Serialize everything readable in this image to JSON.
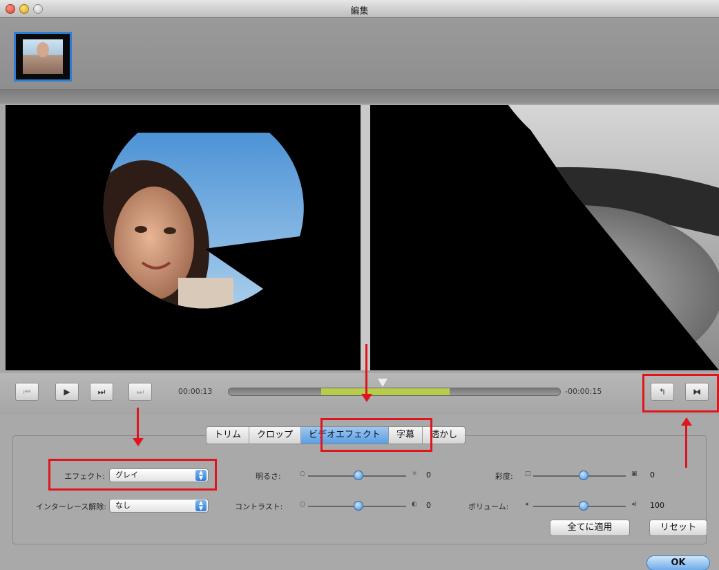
{
  "window": {
    "title": "編集"
  },
  "transport": {
    "buttons": [
      {
        "icon": "skip-back-icon",
        "glyph": "⏮"
      },
      {
        "icon": "play-icon",
        "glyph": "▶"
      },
      {
        "icon": "fast-forward-icon",
        "glyph": "⏭"
      },
      {
        "icon": "skip-end-icon",
        "glyph": "⏭"
      }
    ],
    "time_current": "00:00:13",
    "time_remaining": "-00:00:15",
    "extra_buttons": [
      {
        "icon": "mark-in-icon",
        "glyph": "↰"
      },
      {
        "icon": "split-icon",
        "glyph": "⧓"
      }
    ]
  },
  "tabs": [
    {
      "label": "トリム",
      "active": false
    },
    {
      "label": "クロップ",
      "active": false
    },
    {
      "label": "ビデオエフェクト",
      "active": true
    },
    {
      "label": "字幕",
      "active": false
    },
    {
      "label": "透かし",
      "active": false
    }
  ],
  "effect": {
    "label": "エフェクト:",
    "value": "グレイ"
  },
  "deinterlace": {
    "label": "インターレース解除:",
    "value": "なし"
  },
  "sliders": {
    "brightness": {
      "label": "明るさ:",
      "value": "0"
    },
    "contrast": {
      "label": "コントラスト:",
      "value": "0"
    },
    "saturation": {
      "label": "彩度:",
      "value": "0"
    },
    "volume": {
      "label": "ボリューム:",
      "value": "100"
    }
  },
  "buttons": {
    "apply_all": "全てに適用",
    "reset": "リセット",
    "ok": "OK"
  },
  "colors": {
    "annotation": "#e0141c",
    "active_tab": "#5a9fe4",
    "selection": "#b6cc4a"
  }
}
